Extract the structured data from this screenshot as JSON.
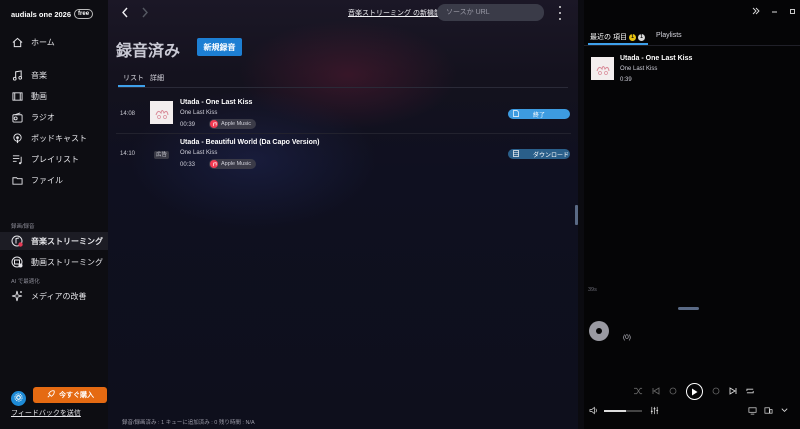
{
  "app": {
    "brand": "audials one 2026",
    "badge": "free"
  },
  "sidebar": {
    "items": [
      {
        "label": "ホーム",
        "icon": "home-icon"
      },
      {
        "label": "音楽",
        "icon": "music-icon"
      },
      {
        "label": "動画",
        "icon": "video-icon"
      },
      {
        "label": "ラジオ",
        "icon": "radio-icon"
      },
      {
        "label": "ポッドキャスト",
        "icon": "podcast-icon"
      },
      {
        "label": "プレイリスト",
        "icon": "playlist-icon"
      },
      {
        "label": "ファイル",
        "icon": "folder-icon"
      }
    ],
    "section_record": "録画/録音",
    "record_items": [
      {
        "label": "音楽ストリーミング",
        "icon": "music-streaming-icon"
      },
      {
        "label": "動画ストリーミング",
        "icon": "video-streaming-icon"
      }
    ],
    "section_ai": "AI で最適化",
    "ai_items": [
      {
        "label": "メディアの改善",
        "icon": "sparkle-icon"
      }
    ],
    "buy_label": "今すぐ購入",
    "feedback": "フィードバックを送信"
  },
  "topbar": {
    "promo_link": "音楽ストリーミング の新機能",
    "search_placeholder": "ソースか URL"
  },
  "main": {
    "title": "録音済み",
    "new_button": "新規録音",
    "tabs": [
      "リスト",
      "詳細"
    ],
    "rows": [
      {
        "time": "14:08",
        "title": "Utada - One Last Kiss",
        "subtitle": "One Last Kiss",
        "duration": "00:39",
        "source": "Apple Music",
        "status": "終了",
        "ad": ""
      },
      {
        "time": "14:10",
        "title": "Utada - Beautiful World (Da Capo Version)",
        "subtitle": "One Last Kiss",
        "duration": "00:33",
        "source": "Apple Music",
        "status": "ダウンロード",
        "ad": "広告"
      }
    ],
    "footer": "録音/録画済み : 1    キューに追加済み : 0    残り時間 : N/A"
  },
  "right_panel": {
    "recent_tab": "最近の 項目",
    "recent_count_a": "1",
    "recent_count_b": "1",
    "playlists_tab": "Playlists",
    "item": {
      "title": "Utada - One Last Kiss",
      "subtitle": "One Last Kiss",
      "duration": "0:39"
    },
    "elapsed_label": "39s",
    "count_label": "(0)"
  },
  "colors": {
    "accent": "#1d7fd3",
    "buy": "#e56a12",
    "status_done": "#3d9be0",
    "status_download": "#2a5f8a",
    "apple_music": "#f23b53"
  }
}
